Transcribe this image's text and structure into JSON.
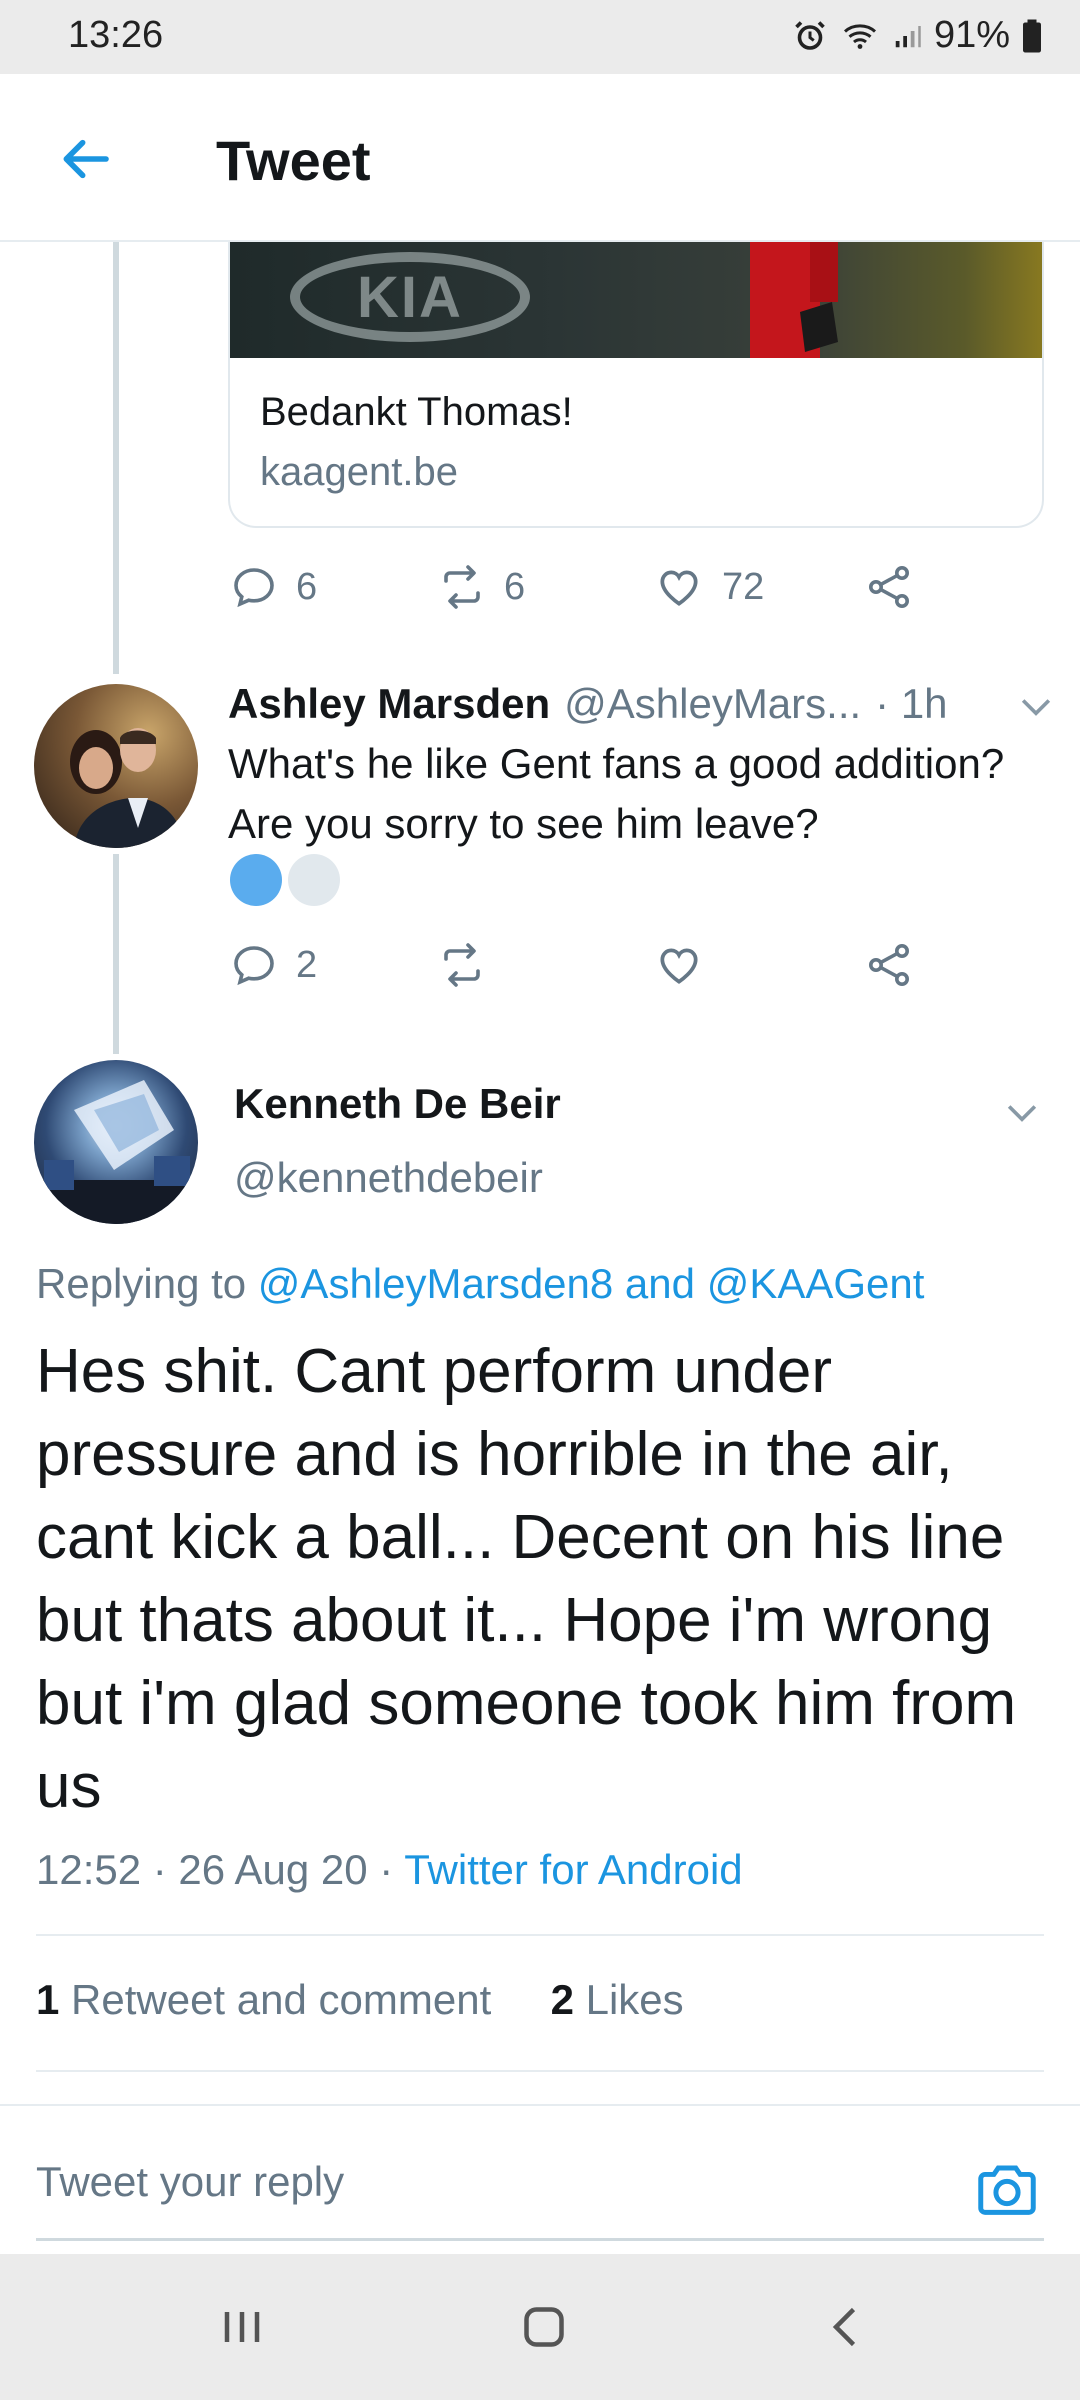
{
  "status_bar": {
    "time": "13:26",
    "battery": "91%",
    "icons": [
      "alarm-icon",
      "wifi-icon",
      "signal-icon",
      "battery-icon"
    ]
  },
  "header": {
    "title": "Tweet",
    "back_icon": "arrow-left-icon"
  },
  "link_card": {
    "title": "Bedankt Thomas!",
    "domain": "kaagent.be",
    "image_text": "KIA"
  },
  "first_actions": {
    "replies": "6",
    "retweets": "6",
    "likes": "72"
  },
  "reply": {
    "name": "Ashley Marsden",
    "handle": "@AshleyMars...",
    "time": "· 1h",
    "text": "What's he like Gent fans a good addition? Are you sorry to see him leave?",
    "actions": {
      "replies": "2",
      "retweets": "",
      "likes": ""
    }
  },
  "main_tweet": {
    "name": "Kenneth De Beir",
    "handle": "@kennethdebeir",
    "replying_prefix": "Replying to ",
    "replying_user1": "@AshleyMarsden8",
    "replying_and": " and ",
    "replying_user2": "@KAAGent",
    "text": "Hes shit. Cant perform under pressure and is horrible in the air, cant kick a ball... Decent on his line but thats about it... Hope i'm wrong but i'm glad someone took him from us",
    "time": "12:52 · 26 Aug 20 · ",
    "source": "Twitter for Android",
    "retweet_count": "1",
    "retweet_label": " Retweet and comment",
    "like_count": "2",
    "like_label": " Likes"
  },
  "compose": {
    "placeholder": "Tweet your reply"
  },
  "colors": {
    "accent": "#1b95e0",
    "secondary_text": "#657786",
    "poll_dot": "#5aacee"
  }
}
